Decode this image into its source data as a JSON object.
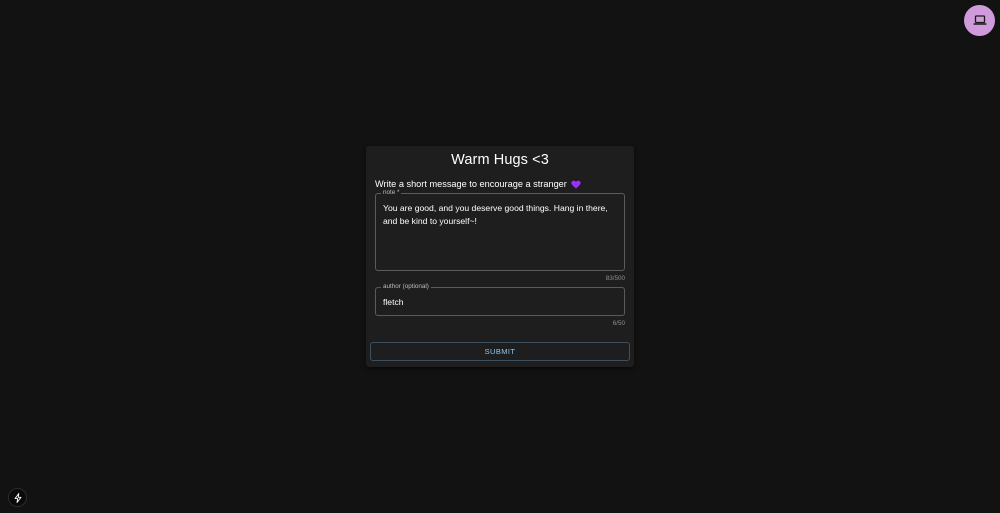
{
  "card": {
    "title": "Warm Hugs <3",
    "prompt": "Write a short message to encourage a stranger",
    "note": {
      "label": "note *",
      "value": "You are good, and you deserve good things. Hang in there,\nand be kind to yourself~!",
      "counter": "83/500"
    },
    "author": {
      "label": "author (optional)",
      "value": "fletch",
      "counter": "6/50"
    },
    "submit_label": "SUBMIT"
  },
  "icons": {
    "prompt_icon": "purple-heart-icon",
    "corner_icon": "laptop-icon",
    "bottom_left_icon": "lightning-bolt-icon"
  },
  "colors": {
    "background": "#121212",
    "card": "#1e1e1e",
    "accent": "#90caf9",
    "corner_button": "#cf9bdb",
    "heart": "#9b30ff"
  }
}
